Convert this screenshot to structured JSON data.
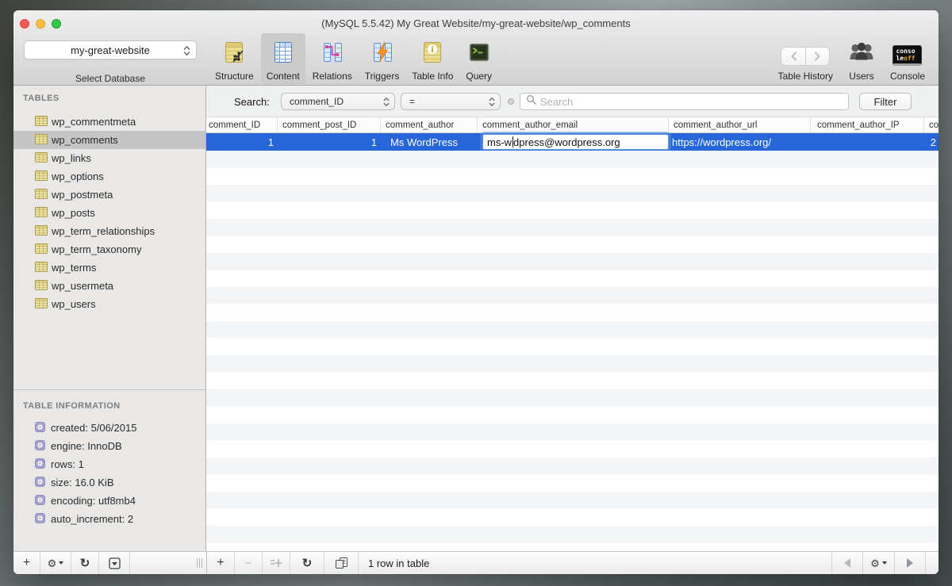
{
  "window": {
    "title": "(MySQL 5.5.42) My Great Website/my-great-website/wp_comments"
  },
  "toolbar": {
    "database_selector": {
      "value": "my-great-website",
      "label": "Select Database"
    },
    "items": [
      {
        "label": "Structure"
      },
      {
        "label": "Content"
      },
      {
        "label": "Relations"
      },
      {
        "label": "Triggers"
      },
      {
        "label": "Table Info"
      },
      {
        "label": "Query"
      }
    ],
    "selected_item": "Content",
    "right_items": [
      {
        "label": "Table History"
      },
      {
        "label": "Users"
      },
      {
        "label": "Console"
      }
    ],
    "console_badge": {
      "line1": "conso",
      "line2_white": "le",
      "line2_accent": "off"
    }
  },
  "sidebar": {
    "tables_header": "TABLES",
    "selected_table": "wp_comments",
    "tables": [
      "wp_commentmeta",
      "wp_comments",
      "wp_links",
      "wp_options",
      "wp_postmeta",
      "wp_posts",
      "wp_term_relationships",
      "wp_term_taxonomy",
      "wp_terms",
      "wp_usermeta",
      "wp_users"
    ],
    "info_header": "TABLE INFORMATION",
    "info_items": [
      "created: 5/06/2015",
      "engine: InnoDB",
      "rows: 1",
      "size: 16.0 KiB",
      "encoding: utf8mb4",
      "auto_increment: 2"
    ]
  },
  "filter_bar": {
    "search_label": "Search:",
    "field_dropdown_value": "comment_ID",
    "operator_dropdown_value": "=",
    "search_placeholder": "Search",
    "filter_button": "Filter"
  },
  "table": {
    "columns": [
      "comment_ID",
      "comment_post_ID",
      "comment_author",
      "comment_author_email",
      "comment_author_url",
      "comment_author_IP",
      "co"
    ],
    "row": {
      "comment_ID": "1",
      "comment_post_ID": "1",
      "comment_author": "Ms WordPress",
      "email_before_caret": "ms-w",
      "email_after_caret": "dpress@wordpress.org",
      "comment_author_url": "https://wordpress.org/",
      "next_column_partial": "2"
    }
  },
  "status_bar": {
    "row_count_text": "1 row in table"
  },
  "colors": {
    "selection_blue": "#2766d8",
    "focus_ring_blue": "#5e95e2",
    "console_off_orange": "#f2a71b",
    "sidebar_selected_gray": "#c5c5c5"
  }
}
